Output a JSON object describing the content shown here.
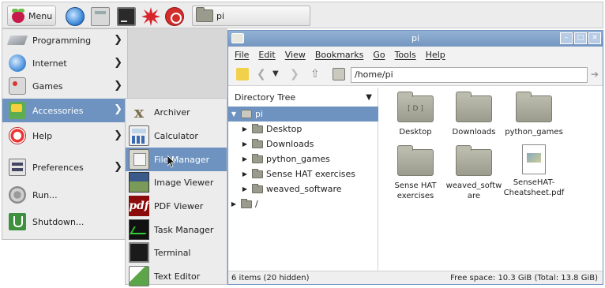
{
  "taskbar": {
    "menu_label": "Menu",
    "task_label": "pi",
    "launchers": [
      "web-browser-icon",
      "calculator-icon",
      "terminal-icon",
      "wolfram-star-icon",
      "mathematica-icon"
    ]
  },
  "main_menu": {
    "items": [
      {
        "label": "Programming",
        "has_submenu": true
      },
      {
        "label": "Internet",
        "has_submenu": true
      },
      {
        "label": "Games",
        "has_submenu": true
      },
      {
        "label": "Accessories",
        "has_submenu": true,
        "selected": true
      },
      {
        "label": "Help",
        "has_submenu": true
      },
      {
        "label": "Preferences",
        "has_submenu": true
      },
      {
        "label": "Run...",
        "has_submenu": false
      },
      {
        "label": "Shutdown...",
        "has_submenu": false
      }
    ],
    "arrow": "❯"
  },
  "accessories_menu": {
    "items": [
      {
        "label": "Archiver"
      },
      {
        "label": "Calculator"
      },
      {
        "label": "File Manager",
        "selected": true
      },
      {
        "label": "Image Viewer"
      },
      {
        "label": "PDF Viewer"
      },
      {
        "label": "Task Manager"
      },
      {
        "label": "Terminal"
      },
      {
        "label": "Text Editor"
      }
    ]
  },
  "file_manager": {
    "title": "pi",
    "menubar": [
      "File",
      "Edit",
      "View",
      "Bookmarks",
      "Go",
      "Tools",
      "Help"
    ],
    "path": "/home/pi",
    "pane_header": "Directory Tree",
    "tree": [
      {
        "label": "pi",
        "selected": true,
        "expanded": true
      },
      {
        "label": "Desktop"
      },
      {
        "label": "Downloads"
      },
      {
        "label": "python_games"
      },
      {
        "label": "Sense HAT exercises"
      },
      {
        "label": "weaved_software"
      },
      {
        "label": "/"
      }
    ],
    "files": [
      {
        "name": "Desktop",
        "kind": "folder"
      },
      {
        "name": "Downloads",
        "kind": "folder"
      },
      {
        "name": "python_games",
        "kind": "folder"
      },
      {
        "name": "Sense HAT\nexercises",
        "kind": "folder"
      },
      {
        "name": "weaved_softw\nare",
        "kind": "folder"
      },
      {
        "name": "SenseHAT-\nCheatsheet.pdf",
        "kind": "pdf"
      }
    ],
    "status_left": "6 items (20 hidden)",
    "status_right": "Free space: 10.3 GiB (Total: 13.8 GiB)"
  },
  "colors": {
    "selection": "#6f93c0",
    "menu_bg": "#ececec",
    "folder": "#9b9b8d"
  }
}
